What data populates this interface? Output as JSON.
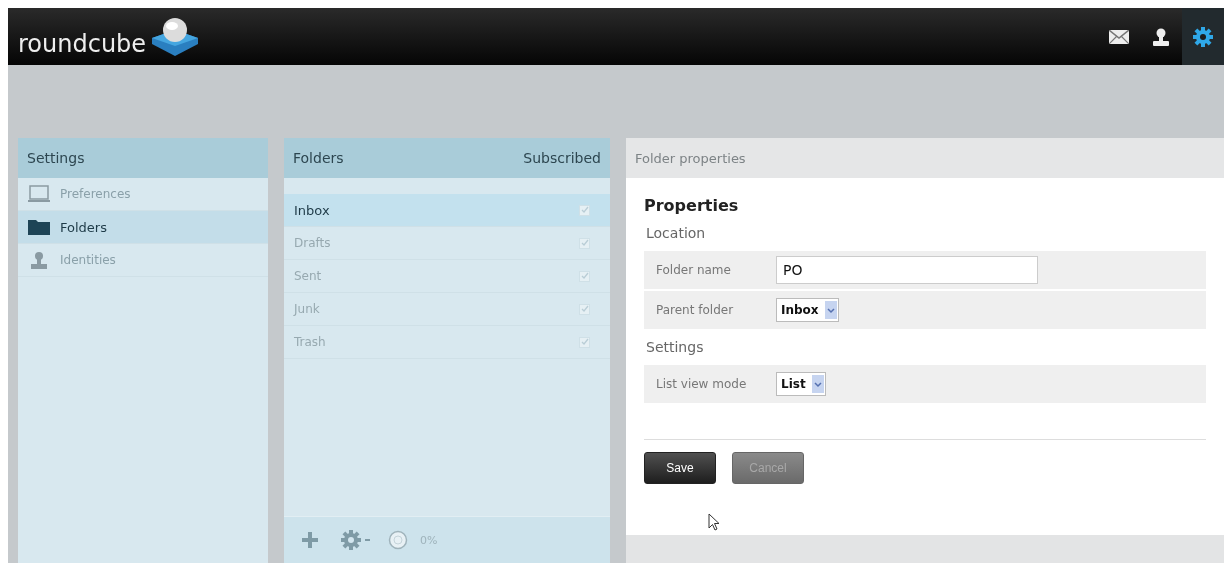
{
  "header": {
    "logo": "roundcube",
    "nav": [
      {
        "kind": "mail",
        "selected": false
      },
      {
        "kind": "contacts",
        "selected": false
      },
      {
        "kind": "settings",
        "selected": true
      }
    ]
  },
  "settings_panel": {
    "title": "Settings",
    "items": [
      {
        "label": "Preferences",
        "kind": "preferences",
        "selected": false
      },
      {
        "label": "Folders",
        "kind": "folders",
        "selected": true
      },
      {
        "label": "Identities",
        "kind": "identities",
        "selected": false
      }
    ]
  },
  "folders_panel": {
    "title": "Folders",
    "subscribed_heading": "Subscribed",
    "folders": [
      {
        "name": "Inbox",
        "selected": true,
        "checked": true
      },
      {
        "name": "Drafts",
        "selected": false,
        "checked": true
      },
      {
        "name": "Sent",
        "selected": false,
        "checked": true
      },
      {
        "name": "Junk",
        "selected": false,
        "checked": true
      },
      {
        "name": "Trash",
        "selected": false,
        "checked": true
      }
    ],
    "quota": "0%"
  },
  "properties_panel": {
    "title": "Folder properties",
    "heading": "Properties",
    "sections": [
      {
        "title": "Location",
        "fields": [
          {
            "label": "Folder name",
            "kind": "text",
            "value": "PO"
          },
          {
            "label": "Parent folder",
            "kind": "select",
            "value": "Inbox"
          }
        ]
      },
      {
        "title": "Settings",
        "fields": [
          {
            "label": "List view mode",
            "kind": "select",
            "value": "List"
          }
        ]
      }
    ],
    "buttons": [
      {
        "label": "Save",
        "disabled": false
      },
      {
        "label": "Cancel",
        "disabled": true
      }
    ]
  }
}
